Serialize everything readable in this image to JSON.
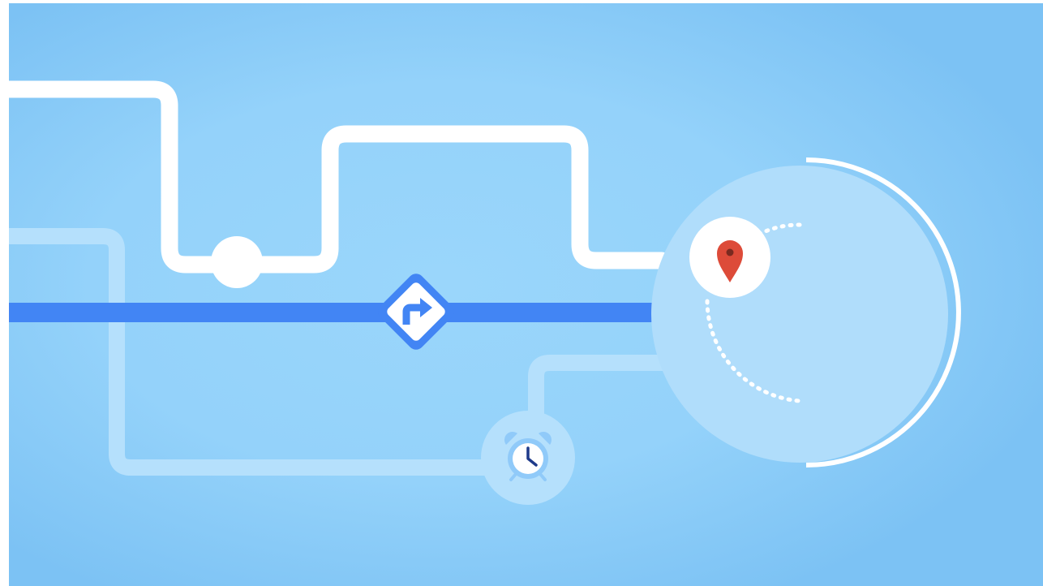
{
  "illustration": {
    "colors": {
      "background_edge": "#7cc2f4",
      "background_center": "#9ad6fb",
      "white_route": "#ffffff",
      "light_route": "#b5e0fc",
      "main_route": "#4285f4",
      "destination_circle": "#b0ddfb",
      "pin": "#dd4b39",
      "pin_dot": "#7a2a20",
      "clock_bell": "#90caf9",
      "clock_hand": "#1e3a8a"
    },
    "icons": [
      "turn-right-sign-icon",
      "map-pin-icon",
      "alarm-clock-icon"
    ]
  }
}
